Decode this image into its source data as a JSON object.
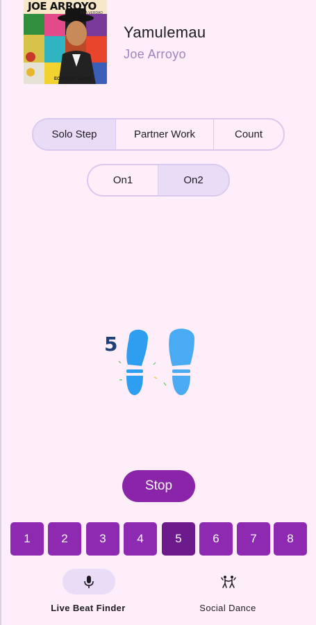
{
  "track": {
    "title": "Yamulemau",
    "artist": "Joe Arroyo",
    "album_art": {
      "artist_text": "JOE ARROYO",
      "sub_text": "Y LA VERDAD",
      "bottom_text": "ECHAO PA' LANTE"
    }
  },
  "mode_selector": {
    "options": [
      "Solo Step",
      "Partner Work",
      "Count"
    ],
    "selected": "Solo Step"
  },
  "timing_selector": {
    "options": [
      "On1",
      "On2"
    ],
    "selected": "On2"
  },
  "step_display": {
    "beat_number": "5",
    "icon": "footprints-icon",
    "left_foot_color": "#2e9ef0",
    "right_foot_color": "#4aaaf2"
  },
  "stop_button": {
    "label": "Stop"
  },
  "beats": {
    "labels": [
      "1",
      "2",
      "3",
      "4",
      "5",
      "6",
      "7",
      "8"
    ],
    "active": "5"
  },
  "bottom_nav": {
    "items": [
      {
        "label": "Live Beat Finder",
        "icon": "microphone-icon",
        "active": true
      },
      {
        "label": "Social Dance",
        "icon": "couple-dance-icon",
        "active": false
      }
    ]
  },
  "colors": {
    "background": "#fdeefa",
    "accent": "#8e2ab2",
    "accent_active": "#6d1a8c",
    "selection": "#e8dcf6",
    "outline": "#dcc8ee",
    "artist_text": "#9d84c0"
  }
}
